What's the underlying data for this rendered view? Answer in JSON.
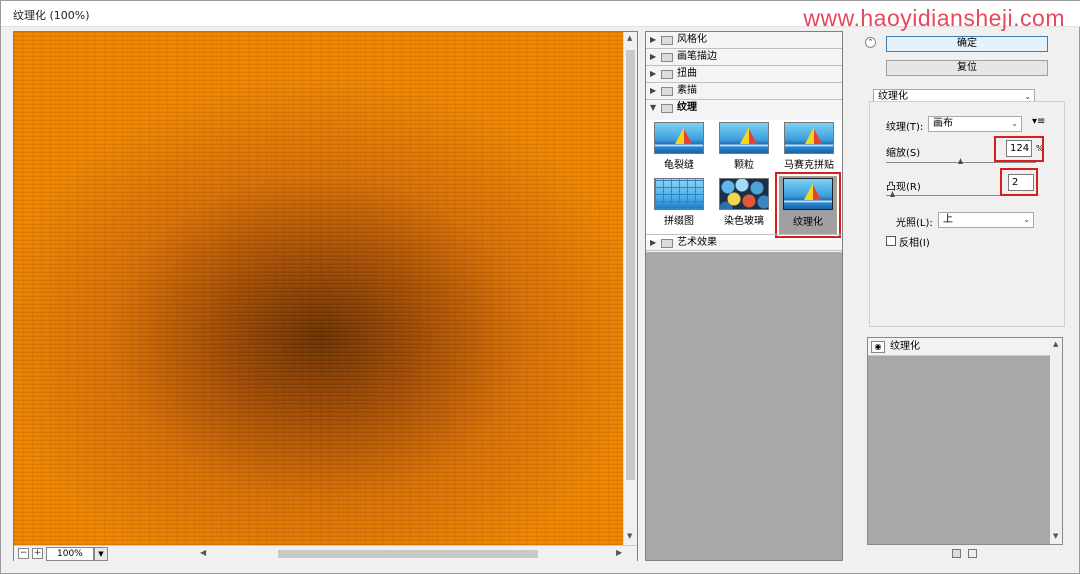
{
  "window": {
    "title": "纹理化 (100%)"
  },
  "watermark": "www.haoyidiansheji.com",
  "preview": {
    "zoom": "100%",
    "zoom_out_icon": "minus-icon",
    "zoom_in_icon": "plus-icon"
  },
  "gallery": {
    "categories": [
      {
        "label": "风格化",
        "expanded": false
      },
      {
        "label": "画笔描边",
        "expanded": false
      },
      {
        "label": "扭曲",
        "expanded": false
      },
      {
        "label": "素描",
        "expanded": false
      },
      {
        "label": "纹理",
        "expanded": true
      },
      {
        "label": "艺术效果",
        "expanded": false
      }
    ],
    "texture_filters": [
      {
        "label": "龟裂缝"
      },
      {
        "label": "颗粒"
      },
      {
        "label": "马赛克拼贴"
      },
      {
        "label": "拼缀图"
      },
      {
        "label": "染色玻璃"
      },
      {
        "label": "纹理化",
        "selected": true
      }
    ]
  },
  "panel": {
    "ok_label": "确定",
    "reset_label": "复位",
    "filter_select": "纹理化",
    "texture_label": "纹理(T):",
    "texture_value": "画布",
    "scaling_label": "缩放(S)",
    "scaling_value": "124",
    "scaling_unit": "%",
    "relief_label": "凸现(R)",
    "relief_value": "2",
    "light_label": "光照(L):",
    "light_value": "上",
    "invert_label": "反相(I)",
    "invert_checked": false,
    "menu_icon": "panel-menu-icon"
  },
  "layers": {
    "items": [
      {
        "label": "纹理化",
        "visible": true
      }
    ]
  },
  "colors": {
    "highlight": "#d81e1e",
    "accent_button_border": "#3c7fb1",
    "watermark": "#e8475c"
  }
}
